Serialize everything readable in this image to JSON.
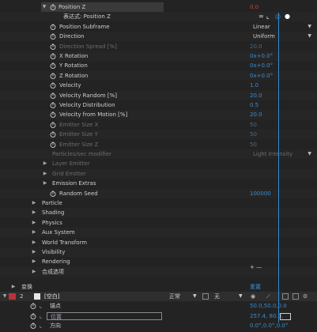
{
  "props": [
    {
      "label": "Position Z",
      "value": "0.0",
      "indent": 74,
      "tri": "▼",
      "sw": false,
      "dim": false,
      "valueStyle": "red",
      "highlight": true
    },
    {
      "label": "表达式: Position Z",
      "value": "",
      "indent": 80,
      "tri": "",
      "sw": false,
      "dim": false,
      "expr": true
    },
    {
      "label": "Position Subframe",
      "dropdown": "Linear",
      "indent": 75,
      "tri": "",
      "sw": true
    },
    {
      "label": "Direction",
      "dropdown": "Uniform",
      "indent": 75,
      "tri": "",
      "sw": true
    },
    {
      "label": "Direction Spread [%]",
      "value": "20.0",
      "indent": 75,
      "tri": "",
      "sw": true,
      "dim": true,
      "valueStyle": "dim"
    },
    {
      "label": "X Rotation",
      "value": "0x+0.0°",
      "indent": 75,
      "tri": "",
      "sw": true
    },
    {
      "label": "Y Rotation",
      "value": "0x+0.0°",
      "indent": 75,
      "tri": "",
      "sw": true
    },
    {
      "label": "Z Rotation",
      "value": "0x+0.0°",
      "indent": 75,
      "tri": "",
      "sw": true
    },
    {
      "label": "Velocity",
      "value": "1.0",
      "indent": 75,
      "tri": "",
      "sw": true
    },
    {
      "label": "Velocity Random [%]",
      "value": "20.0",
      "indent": 75,
      "tri": "",
      "sw": true
    },
    {
      "label": "Velocity Distribution",
      "value": "0.5",
      "indent": 75,
      "tri": "",
      "sw": true
    },
    {
      "label": "Velocity from Motion [%]",
      "value": "20.0",
      "indent": 75,
      "tri": "",
      "sw": true
    },
    {
      "label": "Emitter Size X",
      "value": "50",
      "indent": 75,
      "tri": "",
      "sw": true,
      "dim": true,
      "valueStyle": "dim"
    },
    {
      "label": "Emitter Size Y",
      "value": "50",
      "indent": 75,
      "tri": "",
      "sw": true,
      "dim": true,
      "valueStyle": "dim"
    },
    {
      "label": "Emitter Size Z",
      "value": "50",
      "indent": 75,
      "tri": "",
      "sw": true,
      "dim": true,
      "valueStyle": "dim"
    },
    {
      "label": "Particles/sec modifier",
      "dropdown": "Light Intensity",
      "indent": 66,
      "tri": "",
      "sw": false,
      "dim": true
    },
    {
      "label": "Layer Emitter",
      "value": "",
      "indent": 66,
      "tri": "▶",
      "sw": false,
      "dim": true
    },
    {
      "label": "Grid Emitter",
      "value": "",
      "indent": 66,
      "tri": "▶",
      "sw": false,
      "dim": true
    },
    {
      "label": "Emission Extras",
      "value": "",
      "indent": 66,
      "tri": "▶",
      "sw": false
    },
    {
      "label": "Random Seed",
      "value": "100000",
      "indent": 75,
      "tri": "",
      "sw": true
    }
  ],
  "groups": [
    "Particle",
    "Shading",
    "Physics",
    "Aux System",
    "World Transform",
    "Visibility",
    "Rendering",
    "合成选项"
  ],
  "transform_label": "变换",
  "transform_value": "重置",
  "plus_minus": "+ —",
  "layer": {
    "num": "2",
    "name": "[空白]",
    "mode": "正常",
    "matte": "无"
  },
  "transform_props": [
    {
      "label": "锚点",
      "value": "50.0,50.0,0.0"
    },
    {
      "label": "位置",
      "value": "257.4, 80.0,",
      "highlight": true
    },
    {
      "label": "方向",
      "value": "0.0°,0.0°,0.0°"
    }
  ],
  "colors": {
    "accent": "#2f8bd4",
    "label": "#cfcfcf",
    "layer_red": "#b8343a"
  }
}
